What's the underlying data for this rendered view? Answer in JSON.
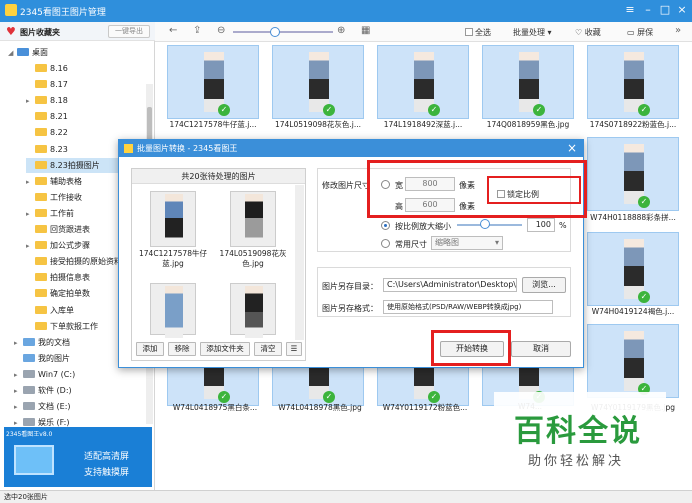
{
  "app": {
    "title": "2345看图王图片管理",
    "status": "选中20张图片"
  },
  "sidebar": {
    "favorites_label": "图片收藏夹",
    "export_label": "一键导出",
    "root": "桌面",
    "items": [
      "8.16",
      "8.17",
      "8.18",
      "8.21",
      "8.22",
      "8.23",
      "8.23拍摄图片",
      "辅助表格",
      "工作接收",
      "工作前",
      "回货跟进表",
      "加公式步骤",
      "接受拍摄的原始资料",
      "拍摄信息表",
      "确定拍单数",
      "入库单",
      "下单款报工作",
      "我的文档",
      "我的图片",
      "Win7 (C:)",
      "软件 (D:)",
      "文档 (E:)",
      "娱乐 (F:)"
    ],
    "banner": {
      "brand": "2345看图王v8.0",
      "line1": "适配高清屏",
      "line2": "支持触摸屏"
    }
  },
  "toolbar": {
    "select_all": "全选",
    "batch": "批量处理",
    "favorite": "收藏",
    "screen": "屏保"
  },
  "grid": {
    "top_labels": [
      "174C1217578牛仔蓝.j...",
      "174L0519098花灰色.j...",
      "174L1918492深蓝.j...",
      "174Q0818959黑色.jpg",
      "174S0718922粉蓝色.j..."
    ],
    "right_labels": [
      "W74H0118888彩条拼...",
      "W74H0419124褐色.j..."
    ],
    "bottom_labels": [
      "W74L0418975黑白条...",
      "W74L0418978黑色.jpg",
      "W74Y0119172粉蓝色...",
      "W74...",
      "W74Y0119179黑色.jpg"
    ]
  },
  "dialog": {
    "title": "批量图片转换 - 2345看图王",
    "list_header": "共20张待处理的图片",
    "thumbs": [
      "174C1217578牛仔蓝.jpg",
      "174L0519098花灰色.jpg"
    ],
    "buttons": {
      "add": "添加",
      "remove": "移除",
      "add_folder": "添加文件夹",
      "clear": "清空"
    },
    "resize_label": "修改图片尺寸",
    "width_label": "宽",
    "width_value": "800",
    "px1": "像素",
    "height_label": "高",
    "height_value": "600",
    "px2": "像素",
    "lock_ratio": "锁定比例",
    "scale_label": "按比例放大缩小",
    "scale_value": "100",
    "percent": "%",
    "common_label": "常用尺寸",
    "common_value": "缩略图",
    "save_dir_label": "图片另存目录：",
    "save_dir_value": "C:\\Users\\Administrator\\Desktop\\",
    "browse": "浏览...",
    "format_label": "图片另存格式：",
    "format_value": "使用原始格式(PSD/RAW/WEBP转换成jpg)",
    "start": "开始转换",
    "cancel": "取消"
  },
  "watermark": {
    "big": "百科全说",
    "small": "助你轻松解决"
  },
  "colors": {
    "accent": "#2f8fdc",
    "highlight": "#e41f1f",
    "ok": "#3cb43c"
  }
}
